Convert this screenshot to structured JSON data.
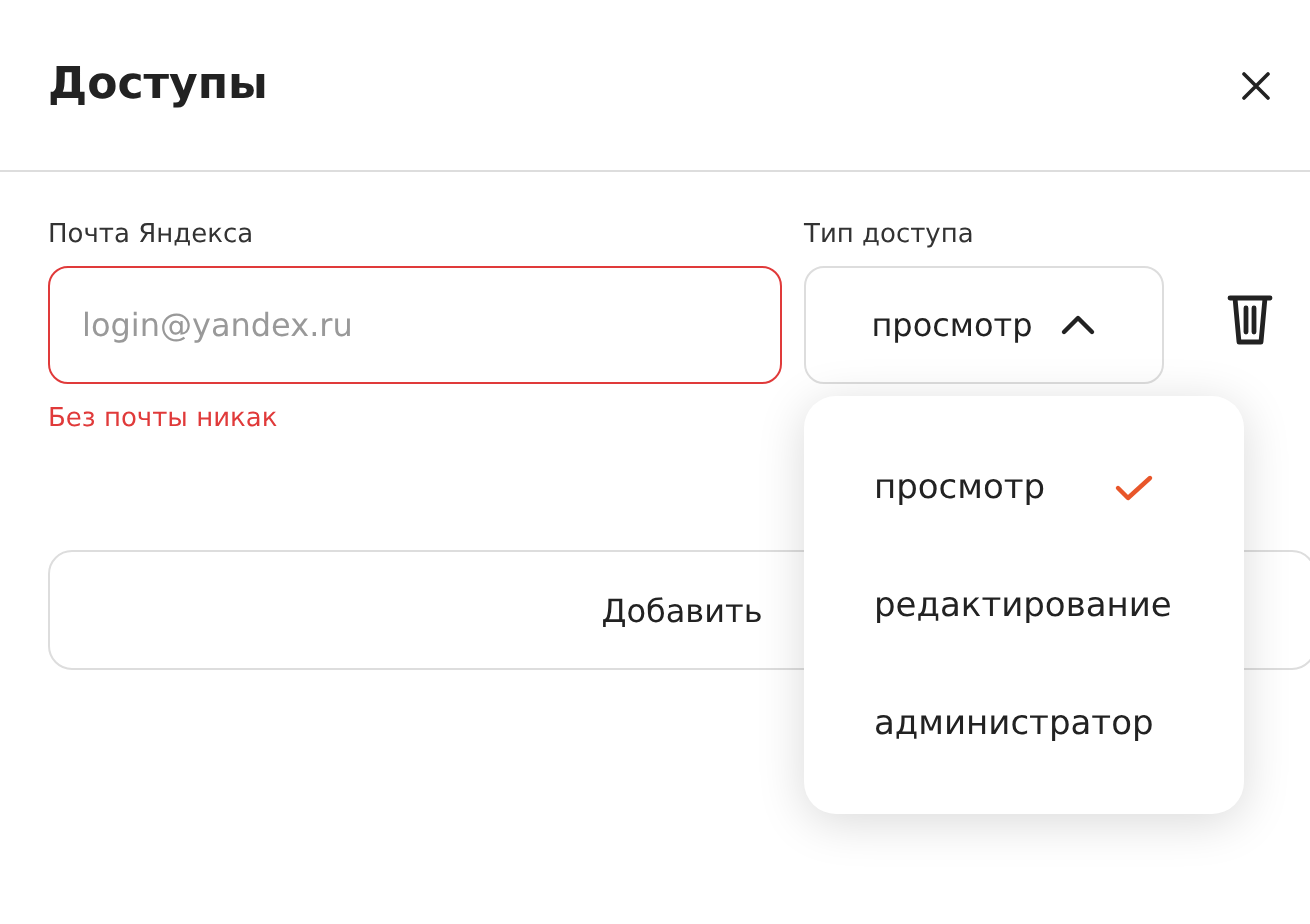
{
  "dialog": {
    "title": "Доступы"
  },
  "email": {
    "label": "Почта Яндекса",
    "placeholder": "login@yandex.ru",
    "invalid": true,
    "error": "Без почты никак"
  },
  "access": {
    "label": "Тип доступа",
    "value": "просмотр",
    "expanded": true,
    "options": [
      {
        "label": "просмотр",
        "selected": true
      },
      {
        "label": "редактирование",
        "selected": false
      },
      {
        "label": "администратор",
        "selected": false
      }
    ]
  },
  "add_button": "Добавить"
}
